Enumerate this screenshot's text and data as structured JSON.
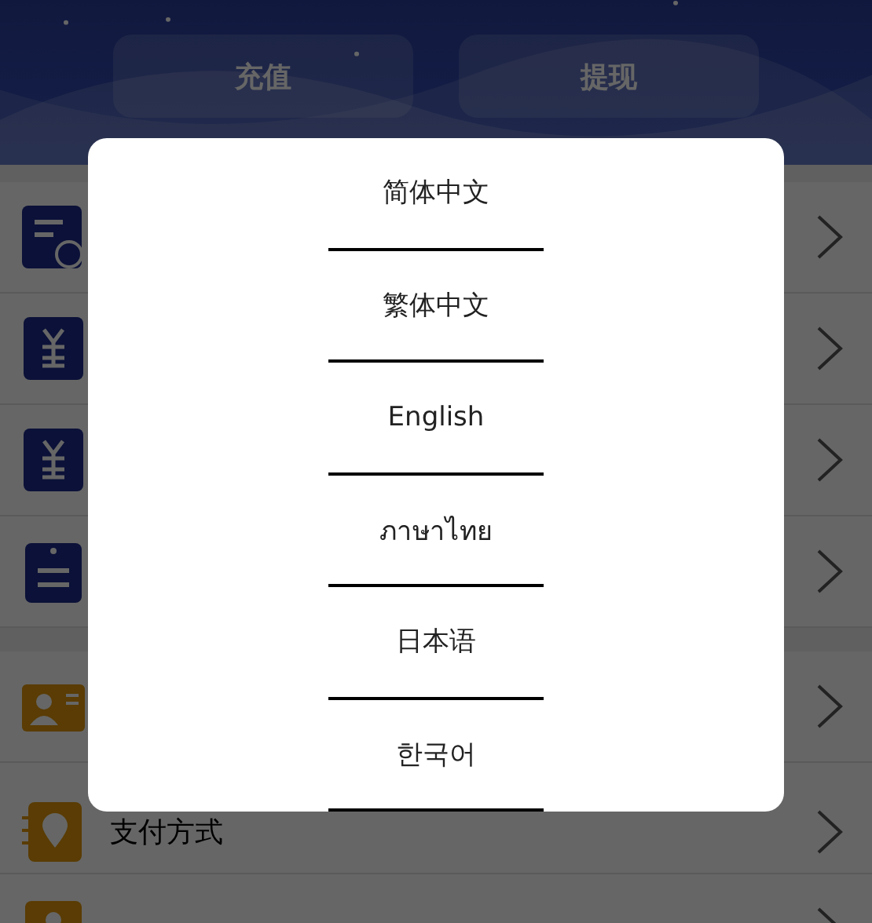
{
  "header": {
    "buttons": [
      {
        "label": "充值"
      },
      {
        "label": "提现"
      }
    ]
  },
  "menu_groups": [
    {
      "items": [
        {
          "kind": "bill"
        },
        {
          "kind": "yen"
        },
        {
          "kind": "yen"
        },
        {
          "kind": "clipboard"
        }
      ]
    },
    {
      "items": [
        {
          "kind": "card"
        },
        {
          "kind": "pin",
          "label": "支付方式"
        },
        {
          "kind": "person"
        }
      ]
    }
  ],
  "language_dialog": {
    "options": [
      {
        "label": "简体中文"
      },
      {
        "label": "繁体中文"
      },
      {
        "label": "English"
      },
      {
        "label": "ภาษาไทย"
      },
      {
        "label": "日本语"
      },
      {
        "label": "한국어"
      }
    ]
  }
}
